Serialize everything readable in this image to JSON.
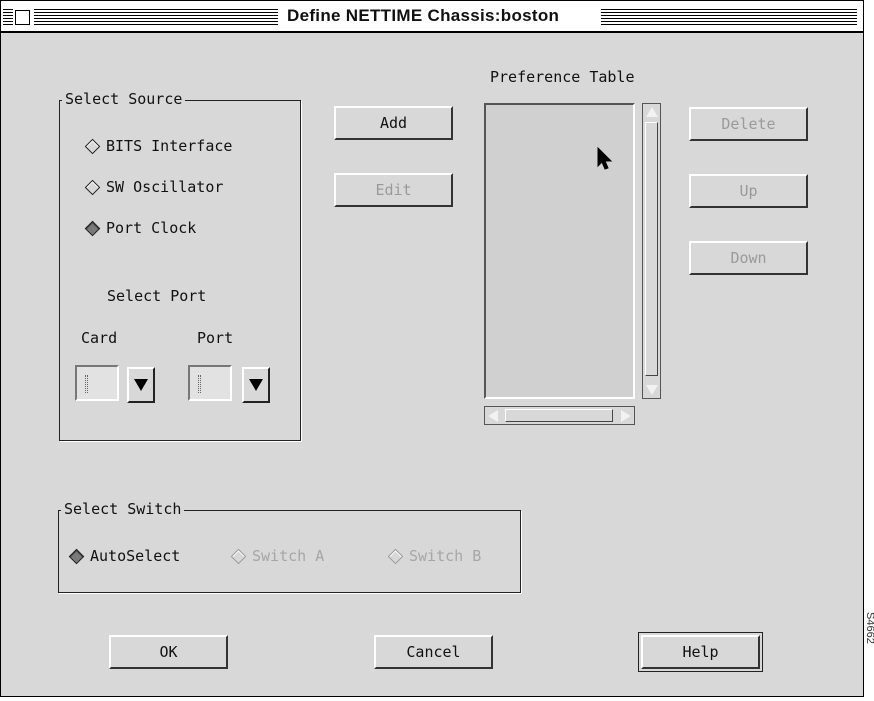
{
  "window": {
    "title": "Define NETTIME Chassis:boston"
  },
  "select_source": {
    "legend": "Select Source",
    "options": [
      {
        "label": "BITS Interface",
        "selected": false,
        "enabled": true
      },
      {
        "label": "SW Oscillator",
        "selected": false,
        "enabled": true
      },
      {
        "label": "Port Clock",
        "selected": true,
        "enabled": true
      }
    ],
    "select_port_label": "Select Port",
    "card_label": "Card",
    "port_label": "Port",
    "card_value": "",
    "port_value": ""
  },
  "buttons": {
    "add": "Add",
    "edit": "Edit",
    "delete": "Delete",
    "up": "Up",
    "down": "Down",
    "ok": "OK",
    "cancel": "Cancel",
    "help": "Help"
  },
  "preference_table": {
    "label": "Preference Table",
    "items": []
  },
  "select_switch": {
    "legend": "Select Switch",
    "options": [
      {
        "label": "AutoSelect",
        "selected": true,
        "enabled": true
      },
      {
        "label": "Switch A",
        "selected": false,
        "enabled": false
      },
      {
        "label": "Switch B",
        "selected": false,
        "enabled": false
      }
    ]
  },
  "figure_code": "S4662"
}
